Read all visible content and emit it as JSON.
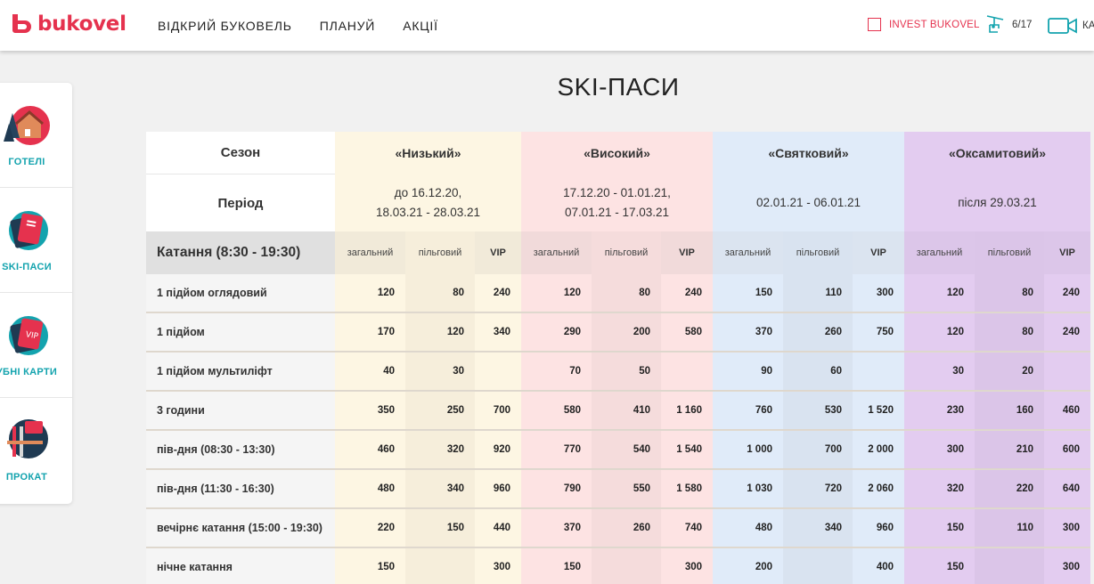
{
  "header": {
    "logo_text": "bukovel",
    "nav": [
      "ВІДКРИЙ БУКОВЕЛЬ",
      "ПЛАНУЙ",
      "АКЦІЇ"
    ],
    "invest_label": "INVEST BUKOVEL",
    "lifts_label": "6/17",
    "cams_label": "КА"
  },
  "sidebar": {
    "items": [
      {
        "label": "ГОТЕЛІ",
        "icon": "hotel-icon"
      },
      {
        "label": "SKI-ПАСИ",
        "icon": "ski-pass-icon"
      },
      {
        "label": "УБНІ КАРТИ",
        "icon": "club-card-icon"
      },
      {
        "label": "ПРОКАТ",
        "icon": "rental-icon"
      }
    ]
  },
  "page_title": "SKI-ПАСИ",
  "table": {
    "season_label": "Сезон",
    "period_label": "Період",
    "riding_label": "Катання (8:30 - 19:30)",
    "sub_labels": [
      "загальний",
      "пільговий",
      "VIP"
    ],
    "seasons": [
      {
        "name": "«Низький»",
        "period_line1": "до 16.12.20,",
        "period_line2": "18.03.21 - 28.03.21",
        "color": "#fdf6e3",
        "color_alt": "#f6eedb"
      },
      {
        "name": "«Високий»",
        "period_line1": "17.12.20 - 01.01.21,",
        "period_line2": "07.01.21 - 17.03.21",
        "color": "#fde3e3",
        "color_alt": "#f5dcdc"
      },
      {
        "name": "«Святковий»",
        "period_line1": "02.01.21 - 06.01.21",
        "period_line2": "",
        "color": "#e0ebf9",
        "color_alt": "#d9e3f0"
      },
      {
        "name": "«Оксамитовий»",
        "period_line1": "після 29.03.21",
        "period_line2": "",
        "color": "#e3ccf0",
        "color_alt": "#dbc5e8"
      }
    ],
    "rows": [
      {
        "name": "1 підйом оглядовий",
        "values": [
          "120",
          "80",
          "240",
          "120",
          "80",
          "240",
          "150",
          "110",
          "300",
          "120",
          "80",
          "240"
        ]
      },
      {
        "name": "1 підйом",
        "values": [
          "170",
          "120",
          "340",
          "290",
          "200",
          "580",
          "370",
          "260",
          "750",
          "120",
          "80",
          "240"
        ]
      },
      {
        "name": "1 підйом мультиліфт",
        "values": [
          "40",
          "30",
          "",
          "70",
          "50",
          "",
          "90",
          "60",
          "",
          "30",
          "20",
          ""
        ]
      },
      {
        "name": "3 години",
        "values": [
          "350",
          "250",
          "700",
          "580",
          "410",
          "1 160",
          "760",
          "530",
          "1 520",
          "230",
          "160",
          "460"
        ]
      },
      {
        "name": "пів-дня (08:30 - 13:30)",
        "values": [
          "460",
          "320",
          "920",
          "770",
          "540",
          "1 540",
          "1 000",
          "700",
          "2 000",
          "300",
          "210",
          "600"
        ]
      },
      {
        "name": "пів-дня (11:30 - 16:30)",
        "values": [
          "480",
          "340",
          "960",
          "790",
          "550",
          "1 580",
          "1 030",
          "720",
          "2 060",
          "320",
          "220",
          "640"
        ]
      },
      {
        "name": "вечірнє катання (15:00 - 19:30)",
        "values": [
          "220",
          "150",
          "440",
          "370",
          "260",
          "740",
          "480",
          "340",
          "960",
          "150",
          "110",
          "300"
        ]
      },
      {
        "name": "нічне катання",
        "values": [
          "150",
          "",
          "300",
          "150",
          "",
          "300",
          "200",
          "",
          "400",
          "150",
          "",
          "300"
        ]
      }
    ]
  },
  "colors": {
    "brand": "#e5324e",
    "accent": "#13a3ae"
  }
}
